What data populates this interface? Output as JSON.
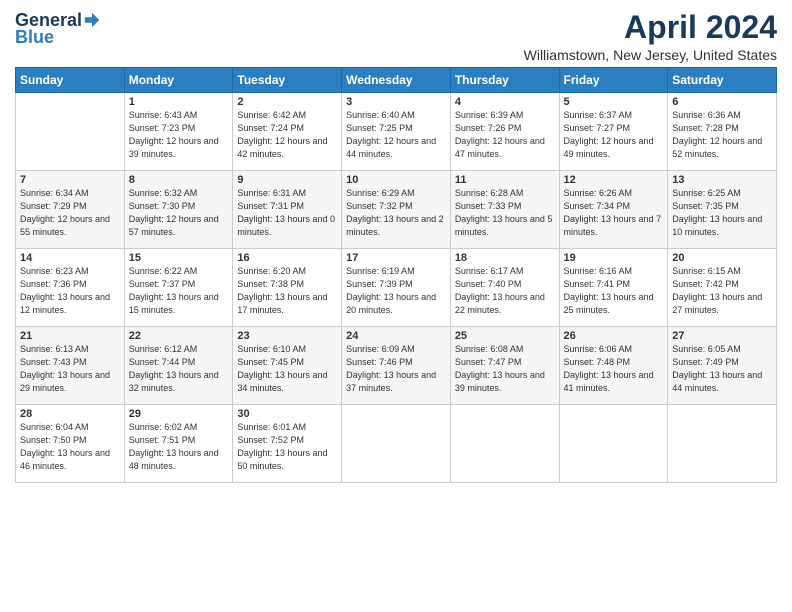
{
  "header": {
    "logo_general": "General",
    "logo_blue": "Blue",
    "title": "April 2024",
    "location": "Williamstown, New Jersey, United States"
  },
  "days_of_week": [
    "Sunday",
    "Monday",
    "Tuesday",
    "Wednesday",
    "Thursday",
    "Friday",
    "Saturday"
  ],
  "weeks": [
    [
      {
        "day": "",
        "sunrise": "",
        "sunset": "",
        "daylight": ""
      },
      {
        "day": "1",
        "sunrise": "Sunrise: 6:43 AM",
        "sunset": "Sunset: 7:23 PM",
        "daylight": "Daylight: 12 hours and 39 minutes."
      },
      {
        "day": "2",
        "sunrise": "Sunrise: 6:42 AM",
        "sunset": "Sunset: 7:24 PM",
        "daylight": "Daylight: 12 hours and 42 minutes."
      },
      {
        "day": "3",
        "sunrise": "Sunrise: 6:40 AM",
        "sunset": "Sunset: 7:25 PM",
        "daylight": "Daylight: 12 hours and 44 minutes."
      },
      {
        "day": "4",
        "sunrise": "Sunrise: 6:39 AM",
        "sunset": "Sunset: 7:26 PM",
        "daylight": "Daylight: 12 hours and 47 minutes."
      },
      {
        "day": "5",
        "sunrise": "Sunrise: 6:37 AM",
        "sunset": "Sunset: 7:27 PM",
        "daylight": "Daylight: 12 hours and 49 minutes."
      },
      {
        "day": "6",
        "sunrise": "Sunrise: 6:36 AM",
        "sunset": "Sunset: 7:28 PM",
        "daylight": "Daylight: 12 hours and 52 minutes."
      }
    ],
    [
      {
        "day": "7",
        "sunrise": "Sunrise: 6:34 AM",
        "sunset": "Sunset: 7:29 PM",
        "daylight": "Daylight: 12 hours and 55 minutes."
      },
      {
        "day": "8",
        "sunrise": "Sunrise: 6:32 AM",
        "sunset": "Sunset: 7:30 PM",
        "daylight": "Daylight: 12 hours and 57 minutes."
      },
      {
        "day": "9",
        "sunrise": "Sunrise: 6:31 AM",
        "sunset": "Sunset: 7:31 PM",
        "daylight": "Daylight: 13 hours and 0 minutes."
      },
      {
        "day": "10",
        "sunrise": "Sunrise: 6:29 AM",
        "sunset": "Sunset: 7:32 PM",
        "daylight": "Daylight: 13 hours and 2 minutes."
      },
      {
        "day": "11",
        "sunrise": "Sunrise: 6:28 AM",
        "sunset": "Sunset: 7:33 PM",
        "daylight": "Daylight: 13 hours and 5 minutes."
      },
      {
        "day": "12",
        "sunrise": "Sunrise: 6:26 AM",
        "sunset": "Sunset: 7:34 PM",
        "daylight": "Daylight: 13 hours and 7 minutes."
      },
      {
        "day": "13",
        "sunrise": "Sunrise: 6:25 AM",
        "sunset": "Sunset: 7:35 PM",
        "daylight": "Daylight: 13 hours and 10 minutes."
      }
    ],
    [
      {
        "day": "14",
        "sunrise": "Sunrise: 6:23 AM",
        "sunset": "Sunset: 7:36 PM",
        "daylight": "Daylight: 13 hours and 12 minutes."
      },
      {
        "day": "15",
        "sunrise": "Sunrise: 6:22 AM",
        "sunset": "Sunset: 7:37 PM",
        "daylight": "Daylight: 13 hours and 15 minutes."
      },
      {
        "day": "16",
        "sunrise": "Sunrise: 6:20 AM",
        "sunset": "Sunset: 7:38 PM",
        "daylight": "Daylight: 13 hours and 17 minutes."
      },
      {
        "day": "17",
        "sunrise": "Sunrise: 6:19 AM",
        "sunset": "Sunset: 7:39 PM",
        "daylight": "Daylight: 13 hours and 20 minutes."
      },
      {
        "day": "18",
        "sunrise": "Sunrise: 6:17 AM",
        "sunset": "Sunset: 7:40 PM",
        "daylight": "Daylight: 13 hours and 22 minutes."
      },
      {
        "day": "19",
        "sunrise": "Sunrise: 6:16 AM",
        "sunset": "Sunset: 7:41 PM",
        "daylight": "Daylight: 13 hours and 25 minutes."
      },
      {
        "day": "20",
        "sunrise": "Sunrise: 6:15 AM",
        "sunset": "Sunset: 7:42 PM",
        "daylight": "Daylight: 13 hours and 27 minutes."
      }
    ],
    [
      {
        "day": "21",
        "sunrise": "Sunrise: 6:13 AM",
        "sunset": "Sunset: 7:43 PM",
        "daylight": "Daylight: 13 hours and 29 minutes."
      },
      {
        "day": "22",
        "sunrise": "Sunrise: 6:12 AM",
        "sunset": "Sunset: 7:44 PM",
        "daylight": "Daylight: 13 hours and 32 minutes."
      },
      {
        "day": "23",
        "sunrise": "Sunrise: 6:10 AM",
        "sunset": "Sunset: 7:45 PM",
        "daylight": "Daylight: 13 hours and 34 minutes."
      },
      {
        "day": "24",
        "sunrise": "Sunrise: 6:09 AM",
        "sunset": "Sunset: 7:46 PM",
        "daylight": "Daylight: 13 hours and 37 minutes."
      },
      {
        "day": "25",
        "sunrise": "Sunrise: 6:08 AM",
        "sunset": "Sunset: 7:47 PM",
        "daylight": "Daylight: 13 hours and 39 minutes."
      },
      {
        "day": "26",
        "sunrise": "Sunrise: 6:06 AM",
        "sunset": "Sunset: 7:48 PM",
        "daylight": "Daylight: 13 hours and 41 minutes."
      },
      {
        "day": "27",
        "sunrise": "Sunrise: 6:05 AM",
        "sunset": "Sunset: 7:49 PM",
        "daylight": "Daylight: 13 hours and 44 minutes."
      }
    ],
    [
      {
        "day": "28",
        "sunrise": "Sunrise: 6:04 AM",
        "sunset": "Sunset: 7:50 PM",
        "daylight": "Daylight: 13 hours and 46 minutes."
      },
      {
        "day": "29",
        "sunrise": "Sunrise: 6:02 AM",
        "sunset": "Sunset: 7:51 PM",
        "daylight": "Daylight: 13 hours and 48 minutes."
      },
      {
        "day": "30",
        "sunrise": "Sunrise: 6:01 AM",
        "sunset": "Sunset: 7:52 PM",
        "daylight": "Daylight: 13 hours and 50 minutes."
      },
      {
        "day": "",
        "sunrise": "",
        "sunset": "",
        "daylight": ""
      },
      {
        "day": "",
        "sunrise": "",
        "sunset": "",
        "daylight": ""
      },
      {
        "day": "",
        "sunrise": "",
        "sunset": "",
        "daylight": ""
      },
      {
        "day": "",
        "sunrise": "",
        "sunset": "",
        "daylight": ""
      }
    ]
  ]
}
